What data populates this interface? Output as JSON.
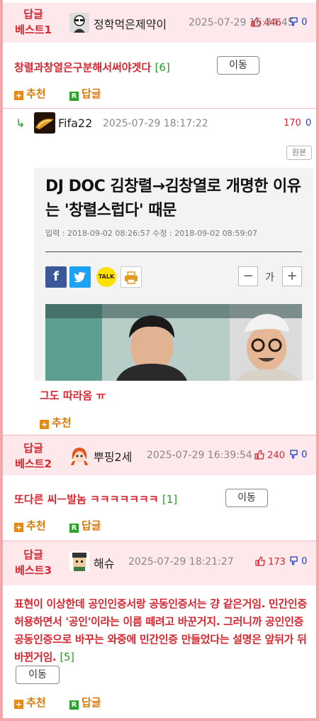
{
  "best1": {
    "label_line1": "답글",
    "label_line2": "베스트1",
    "nick": "정학먹은제약이",
    "date": "2025-07-29 16:34:45",
    "up": "446",
    "down": "0",
    "title": "창렬과창열은구분해서써야겟다",
    "count": "[6]",
    "move": "이동",
    "recommend": "추천",
    "reply": "답글"
  },
  "reply": {
    "nick": "Fifa22",
    "date": "2025-07-29 18:17:22",
    "up": "170",
    "down": "0",
    "origin": "원본",
    "article": {
      "title": "DJ DOC 김창렬→김창열로 개명한 이유는 '창렬스럽다' 때문",
      "meta": "입력 : 2018-09-02 08:26:57 수정 : 2018-09-02 08:59:07",
      "font_label": "가",
      "minus": "−",
      "plus": "+",
      "kakao": "TALK"
    },
    "text": "그도 따라옴 ㅠ",
    "recommend": "추천"
  },
  "best2": {
    "label_line1": "답글",
    "label_line2": "베스트2",
    "nick": "뿌핑2세",
    "date": "2025-07-29 16:39:54",
    "up": "240",
    "down": "0",
    "title": "또다른 씨ㅡ발놈 ㅋㅋㅋㅋㅋㅋㅋ",
    "count": "[1]",
    "move": "이동",
    "recommend": "추천",
    "reply": "답글"
  },
  "best3": {
    "label_line1": "답글",
    "label_line2": "베스트3",
    "nick": "해슈",
    "date": "2025-07-29 18:21:27",
    "up": "173",
    "down": "0",
    "title": "표현이 이상한데 공인인증서랑 공동인증서는 걍 같은거임. 민간인증 허용하면서 '공인'이라는 이름 떼려고 바꾼거지. 그러니까 공인인증 공동인증으로 바꾸는 와중에 민간인증 만들었다는 설명은 앞뒤가 뒤바뀐거임.",
    "count": "[5]",
    "move": "이동",
    "recommend": "추천",
    "reply": "답글"
  },
  "colors": {
    "accent_red": "#d42731",
    "best_bg": "#fde9eb",
    "border": "#f2a7ad",
    "green": "#2a9a2a",
    "orange": "#d8790b",
    "down_blue": "#1d3ebd"
  }
}
